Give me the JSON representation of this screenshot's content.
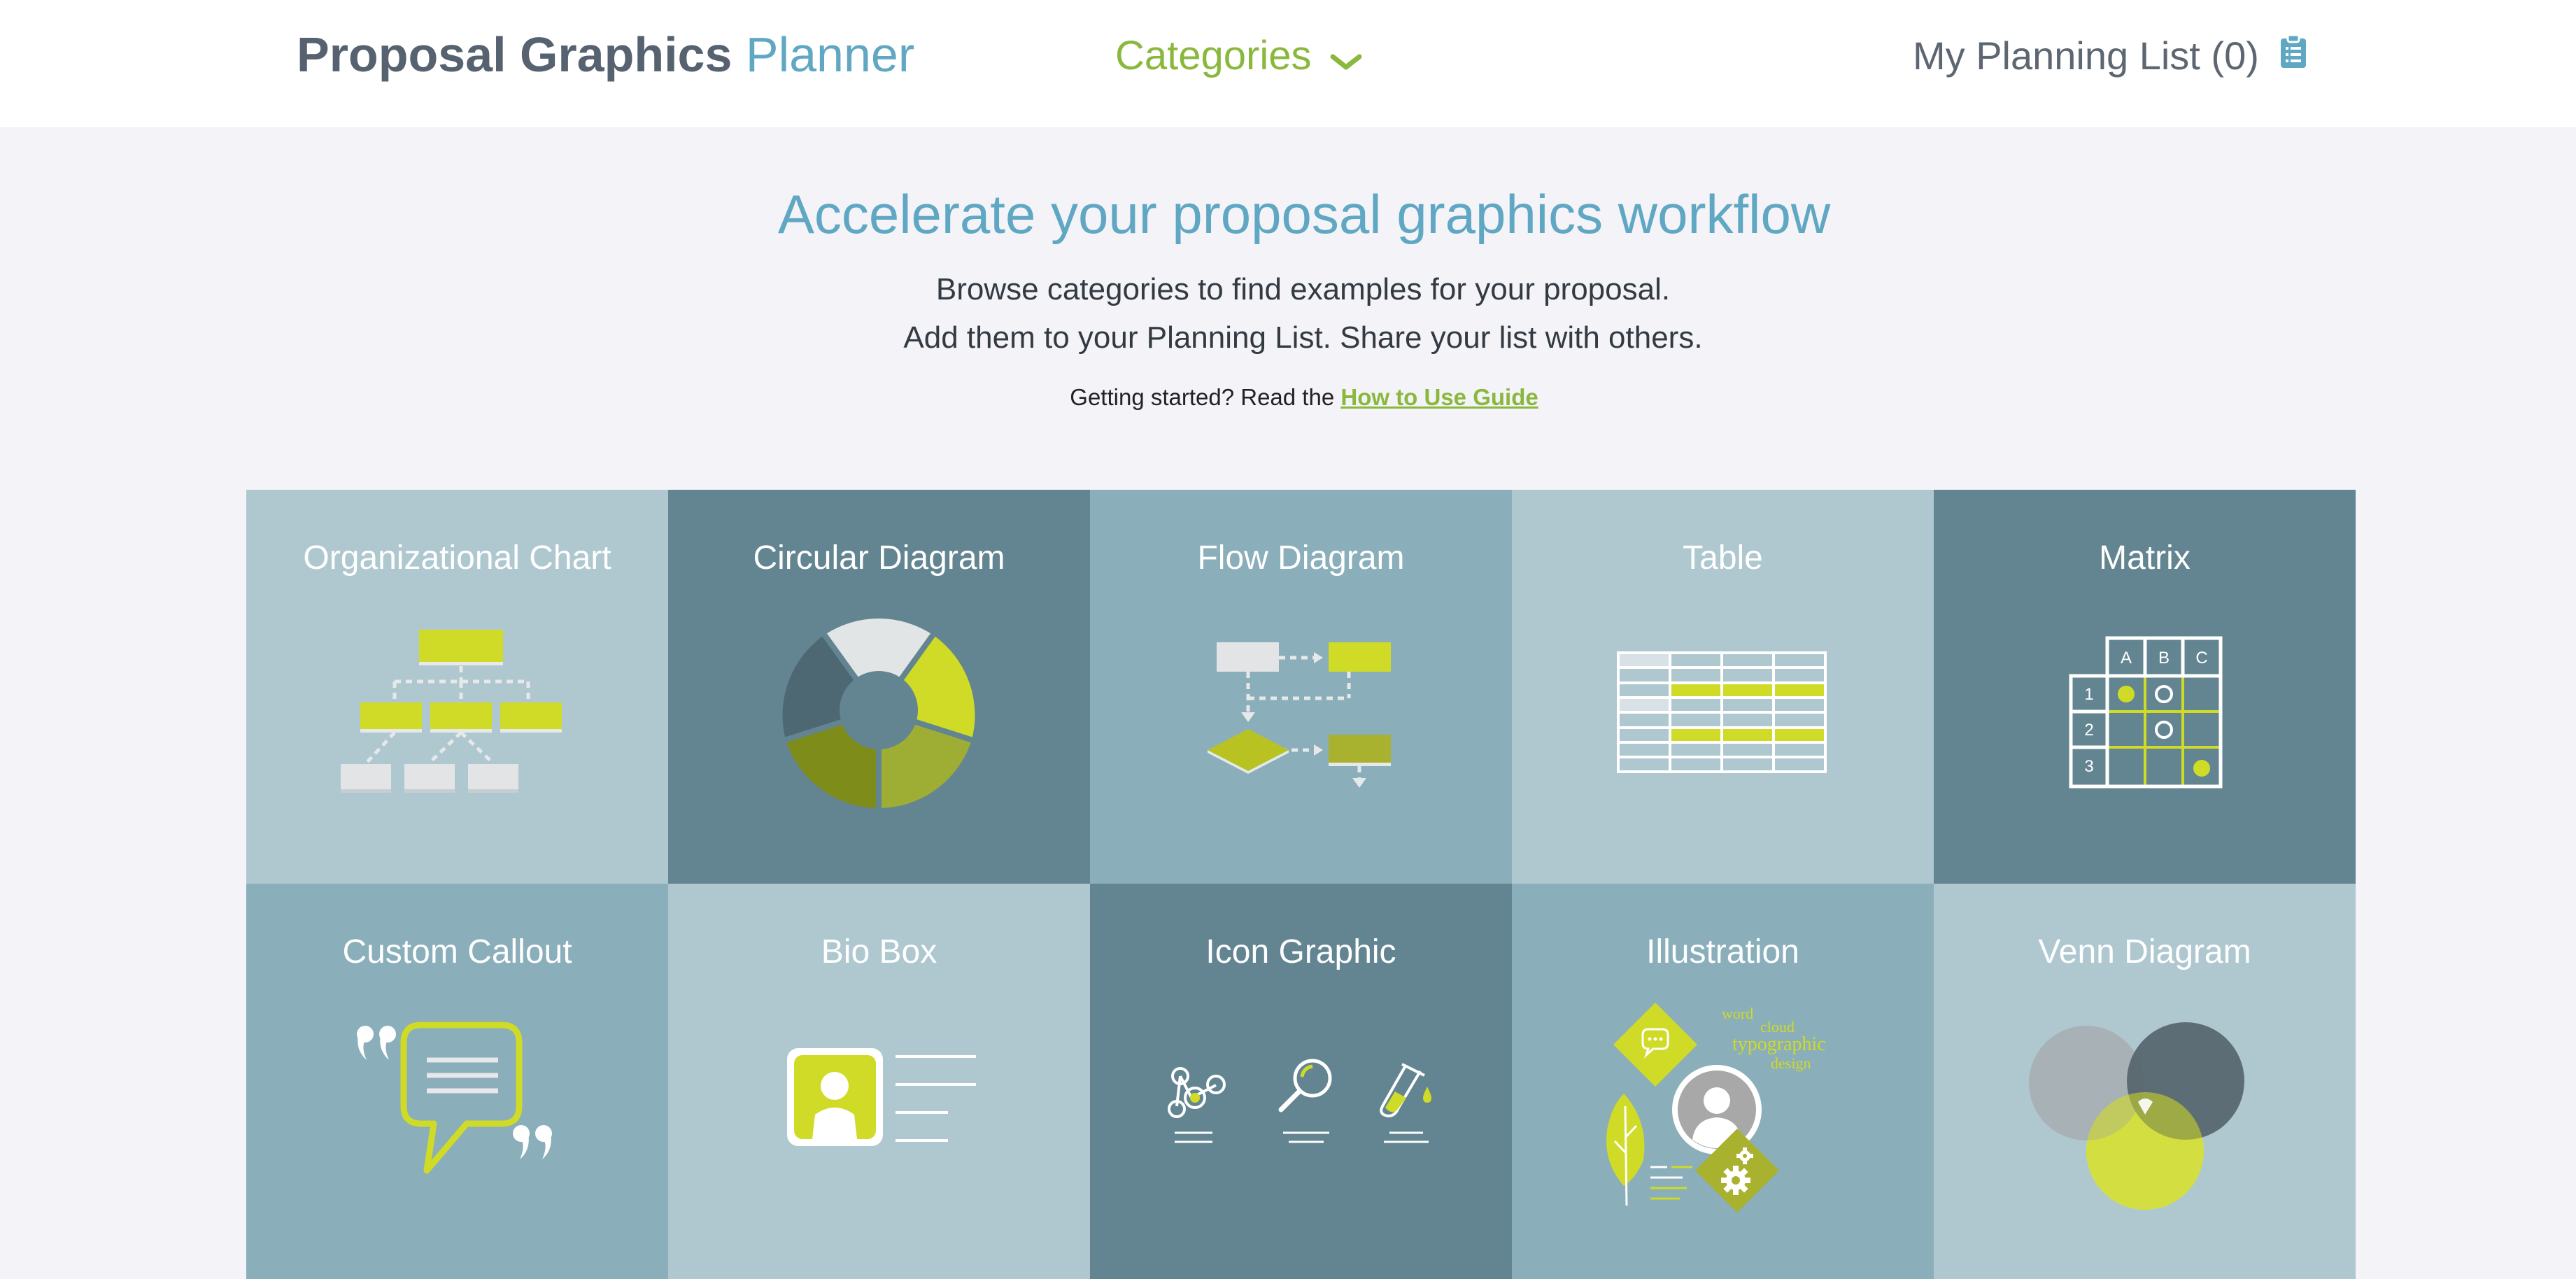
{
  "header": {
    "brand_bold": "Proposal Graphics",
    "brand_light": "Planner",
    "categories_label": "Categories",
    "planning_list_label": "My Planning List (0)"
  },
  "hero": {
    "title": "Accelerate your proposal graphics workflow",
    "line1": "Browse categories to find examples for your proposal.",
    "line2": "Add them to your Planning List. Share your list with others.",
    "guide_prefix": "Getting started? Read the",
    "guide_link": "How to Use Guide"
  },
  "tiles": [
    {
      "label": "Organizational Chart",
      "icon": "org-chart-icon"
    },
    {
      "label": "Circular Diagram",
      "icon": "circular-diagram-icon"
    },
    {
      "label": "Flow Diagram",
      "icon": "flow-diagram-icon"
    },
    {
      "label": "Table",
      "icon": "table-icon"
    },
    {
      "label": "Matrix",
      "icon": "matrix-icon"
    },
    {
      "label": "Custom Callout",
      "icon": "callout-icon"
    },
    {
      "label": "Bio Box",
      "icon": "bio-box-icon"
    },
    {
      "label": "Icon Graphic",
      "icon": "icon-graphic-icon"
    },
    {
      "label": "Illustration",
      "icon": "illustration-icon"
    },
    {
      "label": "Venn Diagram",
      "icon": "venn-diagram-icon"
    }
  ],
  "matrix_labels": {
    "cols": [
      "A",
      "B",
      "C"
    ],
    "rows": [
      "1",
      "2",
      "3"
    ]
  },
  "illustration_words": [
    "word",
    "cloud",
    "typographic",
    "design"
  ],
  "colors": {
    "brand_blue": "#5fa7c2",
    "brand_gray": "#566270",
    "accent_green": "#89b83c",
    "lime": "#cfdb26",
    "olive": "#a8b22e",
    "tile_light": "#afc8d0",
    "tile_dark": "#638491",
    "tile_mid": "#8aaeba",
    "page_bg": "#f3f3f8"
  }
}
